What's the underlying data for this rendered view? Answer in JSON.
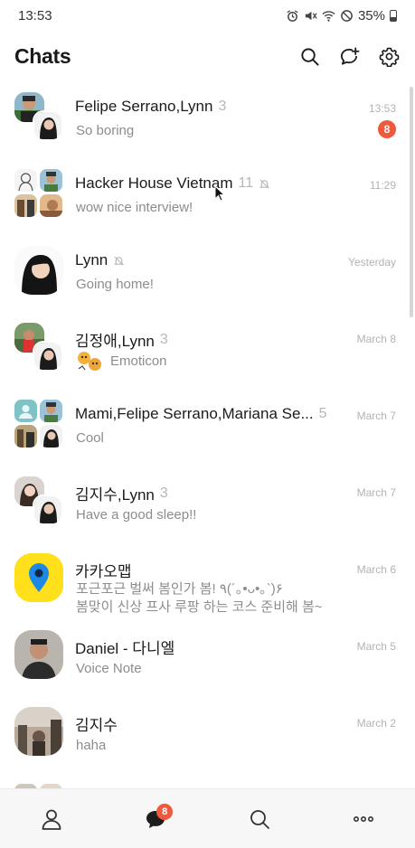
{
  "status_bar": {
    "time": "13:53",
    "battery": "35%"
  },
  "header": {
    "title": "Chats"
  },
  "chats": [
    {
      "name": "Felipe Serrano,Lynn",
      "count": "3",
      "muted": false,
      "preview": "So boring",
      "time": "13:53",
      "badge": "8"
    },
    {
      "name": "Hacker House Vietnam",
      "count": "11",
      "muted": true,
      "preview": "wow nice interview!",
      "time": "11:29"
    },
    {
      "name": "Lynn",
      "count": "",
      "muted": true,
      "preview": "Going home!",
      "time": "Yesterday"
    },
    {
      "name": "김정애,Lynn",
      "count": "3",
      "muted": false,
      "preview": "Emoticon",
      "time": "March 8"
    },
    {
      "name": "Mami,Felipe Serrano,Mariana Se...",
      "count": "5",
      "muted": false,
      "preview": "Cool",
      "time": "March 7"
    },
    {
      "name": "김지수,Lynn",
      "count": "3",
      "muted": false,
      "preview": "Have a good sleep!!",
      "time": "March 7"
    },
    {
      "name": "카카오맵",
      "count": "",
      "muted": false,
      "preview_line1": "포근포근 벌써 봄인가 봄! ٩(´｡•ᴗ•｡`)۶",
      "preview_line2": "봄맞이 신상 프사 루팡 하는 코스 준비해 봄~",
      "time": "March 6"
    },
    {
      "name": "Daniel - 다니엘",
      "count": "",
      "muted": false,
      "preview": "Voice Note",
      "time": "March 5"
    },
    {
      "name": "김지수",
      "count": "",
      "muted": false,
      "preview": "haha",
      "time": "March 2"
    }
  ],
  "bottom_nav": {
    "chats_badge": "8"
  },
  "colors": {
    "badge": "#ef5a3c",
    "kakaomap_bg": "#ffe01b",
    "kakaomap_pin": "#1e88e5"
  }
}
